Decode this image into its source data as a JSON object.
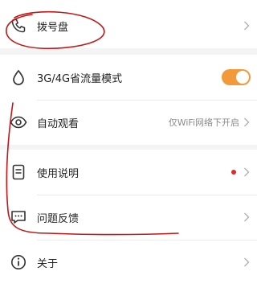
{
  "settings": {
    "dialpad": {
      "label": "拨号盘",
      "icon": "phone-icon"
    },
    "data_saver": {
      "label": "3G/4G省流量模式",
      "icon": "droplet-icon",
      "enabled": true
    },
    "autoplay": {
      "label": "自动观看",
      "value": "仅WiFi网络下开启",
      "icon": "eye-icon"
    },
    "manual": {
      "label": "使用说明",
      "icon": "document-icon",
      "has_badge": true
    },
    "feedback": {
      "label": "问题反馈",
      "icon": "chat-bubble-icon"
    },
    "about": {
      "label": "关于",
      "icon": "info-icon"
    }
  },
  "colors": {
    "accent": "#f29a3a",
    "badge": "#e02a2a",
    "annotation": "#c01818"
  }
}
